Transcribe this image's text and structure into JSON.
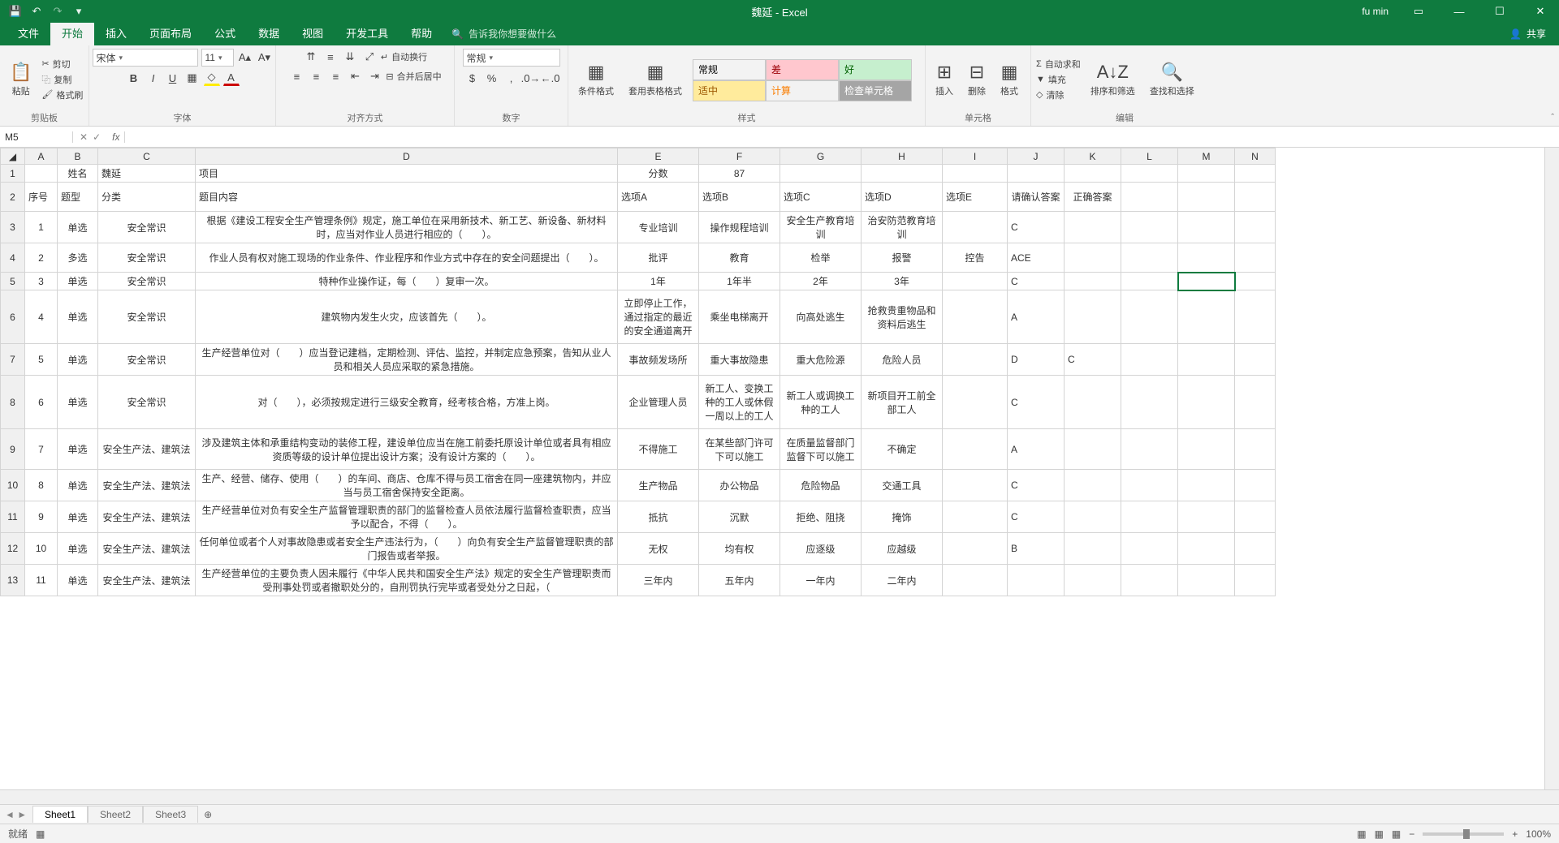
{
  "titlebar": {
    "title": "魏延 - Excel",
    "user": "fu min"
  },
  "menutabs": [
    "文件",
    "开始",
    "插入",
    "页面布局",
    "公式",
    "数据",
    "视图",
    "开发工具",
    "帮助"
  ],
  "tellme": "告诉我你想要做什么",
  "share": "共享",
  "ribbon": {
    "clipboard": {
      "paste": "粘贴",
      "cut": "剪切",
      "copy": "复制",
      "format": "格式刷",
      "label": "剪贴板"
    },
    "font": {
      "name": "宋体",
      "size": "11",
      "label": "字体"
    },
    "align": {
      "wrap": "自动换行",
      "merge": "合并后居中",
      "label": "对齐方式"
    },
    "number": {
      "format": "常规",
      "label": "数字"
    },
    "styles": {
      "cond": "条件格式",
      "table": "套用表格格式",
      "s1": "常规",
      "s2": "差",
      "s3": "好",
      "s4": "适中",
      "s5": "计算",
      "s6": "检查单元格",
      "label": "样式"
    },
    "cells": {
      "insert": "插入",
      "delete": "删除",
      "format": "格式",
      "label": "单元格"
    },
    "editing": {
      "sum": "自动求和",
      "fill": "填充",
      "clear": "清除",
      "sort": "排序和筛选",
      "find": "查找和选择",
      "label": "编辑"
    }
  },
  "namebox": "M5",
  "cols": [
    "A",
    "B",
    "C",
    "D",
    "E",
    "F",
    "G",
    "H",
    "I",
    "J",
    "K",
    "L",
    "M",
    "N"
  ],
  "rows": {
    "r1": {
      "B": "姓名",
      "C": "魏延",
      "D": "项目",
      "E": "分数",
      "F": "87"
    },
    "r2": {
      "A": "序号",
      "B": "题型",
      "C": "分类",
      "D": "题目内容",
      "E": "选项A",
      "F": "选项B",
      "G": "选项C",
      "H": "选项D",
      "I": "选项E",
      "J": "请确认答案",
      "K": "正确答案"
    },
    "r3": {
      "A": "1",
      "B": "单选",
      "C": "安全常识",
      "D": "根据《建设工程安全生产管理条例》规定，施工单位在采用新技术、新工艺、新设备、新材料时，应当对作业人员进行相应的（　　）。",
      "E": "专业培训",
      "F": "操作规程培训",
      "G": "安全生产教育培训",
      "H": "治安防范教育培训",
      "J": "C"
    },
    "r4": {
      "A": "2",
      "B": "多选",
      "C": "安全常识",
      "D": "作业人员有权对施工现场的作业条件、作业程序和作业方式中存在的安全问题提出（　　）。",
      "E": "批评",
      "F": "教育",
      "G": "检举",
      "H": "报警",
      "I": "控告",
      "J": "ACE"
    },
    "r5": {
      "A": "3",
      "B": "单选",
      "C": "安全常识",
      "D": "特种作业操作证，每（　　）复审一次。",
      "E": "1年",
      "F": "1年半",
      "G": "2年",
      "H": "3年",
      "J": "C"
    },
    "r6": {
      "A": "4",
      "B": "单选",
      "C": "安全常识",
      "D": "建筑物内发生火灾，应该首先（　　）。",
      "E": "立即停止工作，通过指定的最近的安全通道离开",
      "F": "乘坐电梯离开",
      "G": "向高处逃生",
      "H": "抢救贵重物品和资料后逃生",
      "J": "A"
    },
    "r7": {
      "A": "5",
      "B": "单选",
      "C": "安全常识",
      "D": "生产经营单位对（　　）应当登记建档，定期检测、评估、监控，并制定应急预案，告知从业人员和相关人员应采取的紧急措施。",
      "E": "事故频发场所",
      "F": "重大事故隐患",
      "G": "重大危险源",
      "H": "危险人员",
      "J": "D",
      "K": "C"
    },
    "r8": {
      "A": "6",
      "B": "单选",
      "C": "安全常识",
      "D": "对（　　），必须按规定进行三级安全教育，经考核合格，方准上岗。",
      "E": "企业管理人员",
      "F": "新工人、变换工种的工人或休假一周以上的工人",
      "G": "新工人或调换工种的工人",
      "H": "新项目开工前全部工人",
      "J": "C"
    },
    "r9": {
      "A": "7",
      "B": "单选",
      "C": "安全生产法、建筑法",
      "D": "涉及建筑主体和承重结构变动的装修工程，建设单位应当在施工前委托原设计单位或者具有相应资质等级的设计单位提出设计方案；没有设计方案的（　　）。",
      "E": "不得施工",
      "F": "在某些部门许可下可以施工",
      "G": "在质量监督部门监督下可以施工",
      "H": "不确定",
      "J": "A"
    },
    "r10": {
      "A": "8",
      "B": "单选",
      "C": "安全生产法、建筑法",
      "D": "生产、经营、储存、使用（　　）的车间、商店、仓库不得与员工宿舍在同一座建筑物内，并应当与员工宿舍保持安全距离。",
      "E": "生产物品",
      "F": "办公物品",
      "G": "危险物品",
      "H": "交通工具",
      "J": "C"
    },
    "r11": {
      "A": "9",
      "B": "单选",
      "C": "安全生产法、建筑法",
      "D": "生产经营单位对负有安全生产监督管理职责的部门的监督检查人员依法履行监督检查职责，应当予以配合，不得（　　）。",
      "E": "抵抗",
      "F": "沉默",
      "G": "拒绝、阻挠",
      "H": "掩饰",
      "J": "C"
    },
    "r12": {
      "A": "10",
      "B": "单选",
      "C": "安全生产法、建筑法",
      "D": "任何单位或者个人对事故隐患或者安全生产违法行为，（　　）向负有安全生产监督管理职责的部门报告或者举报。",
      "E": "无权",
      "F": "均有权",
      "G": "应逐级",
      "H": "应越级",
      "J": "B"
    },
    "r13": {
      "A": "11",
      "B": "单选",
      "C": "安全生产法、建筑法",
      "D": "生产经营单位的主要负责人因未履行《中华人民共和国安全生产法》规定的安全生产管理职责而受刑事处罚或者撤职处分的，自刑罚执行完毕或者受处分之日起，（",
      "E": "三年内",
      "F": "五年内",
      "G": "一年内",
      "H": "二年内"
    }
  },
  "sheets": [
    "Sheet1",
    "Sheet2",
    "Sheet3"
  ],
  "status": {
    "ready": "就绪",
    "zoom": "100%"
  }
}
